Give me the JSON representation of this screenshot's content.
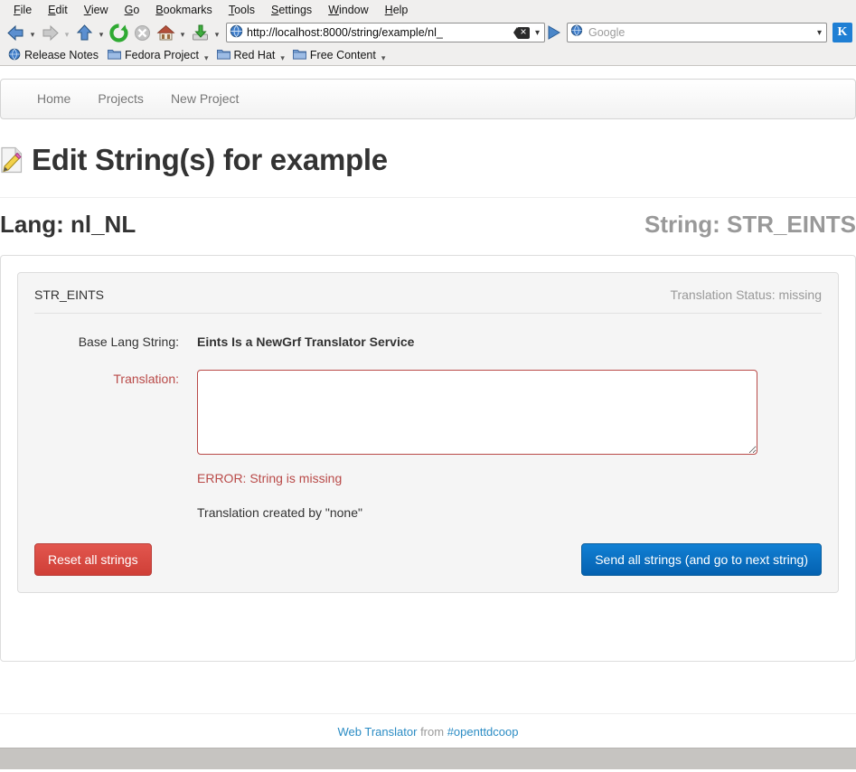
{
  "browser": {
    "menu": [
      {
        "label": "File",
        "accel": "F"
      },
      {
        "label": "Edit",
        "accel": "E"
      },
      {
        "label": "View",
        "accel": "V"
      },
      {
        "label": "Go",
        "accel": "G"
      },
      {
        "label": "Bookmarks",
        "accel": "B"
      },
      {
        "label": "Tools",
        "accel": "T"
      },
      {
        "label": "Settings",
        "accel": "S"
      },
      {
        "label": "Window",
        "accel": "W"
      },
      {
        "label": "Help",
        "accel": "H"
      }
    ],
    "toolbar_icons": [
      "back-icon",
      "forward-icon",
      "up-icon",
      "reload-icon",
      "stop-icon",
      "home-icon",
      "download-icon"
    ],
    "url": "http://localhost:8000/string/example/nl_",
    "url_icon": "globe-icon",
    "url_clear_icon": "clear-text-icon",
    "go_icon": "go-arrow-icon",
    "search_placeholder": "Google",
    "search_icon": "search-globe-icon",
    "logo": "kde-konqueror-logo",
    "logo_glyph": "K",
    "bookmarks": [
      {
        "label": "Release Notes",
        "icon": "globe-icon",
        "has_menu": false
      },
      {
        "label": "Fedora Project",
        "icon": "folder-icon",
        "has_menu": true
      },
      {
        "label": "Red Hat",
        "icon": "folder-icon",
        "has_menu": true
      },
      {
        "label": "Free Content",
        "icon": "folder-icon",
        "has_menu": true
      }
    ]
  },
  "nav": {
    "links": [
      {
        "label": "Home"
      },
      {
        "label": "Projects"
      },
      {
        "label": "New Project"
      }
    ]
  },
  "header": {
    "icon": "memo-pencil-icon",
    "title": "Edit String(s) for example",
    "lang_label": "Lang: nl_NL",
    "string_label": "String: STR_EINTS"
  },
  "panel": {
    "string_id": "STR_EINTS",
    "status": "Translation Status: missing",
    "base_label": "Base Lang String:",
    "base_value": "Eints Is a NewGrf Translator Service",
    "translation_label": "Translation:",
    "translation_value": "",
    "translation_placeholder": "",
    "error": "ERROR: String is missing",
    "created_by": "Translation created by \"none\"",
    "reset_button": "Reset all strings",
    "send_button": "Send all strings (and go to next string)"
  },
  "footer": {
    "link1": "Web Translator",
    "middle": "from",
    "link2": "#openttdcoop"
  },
  "colors": {
    "danger": "#d9534f",
    "primary": "#0571c4",
    "link": "#2b8cc4",
    "error_text": "#b94a48",
    "muted": "#999999"
  }
}
